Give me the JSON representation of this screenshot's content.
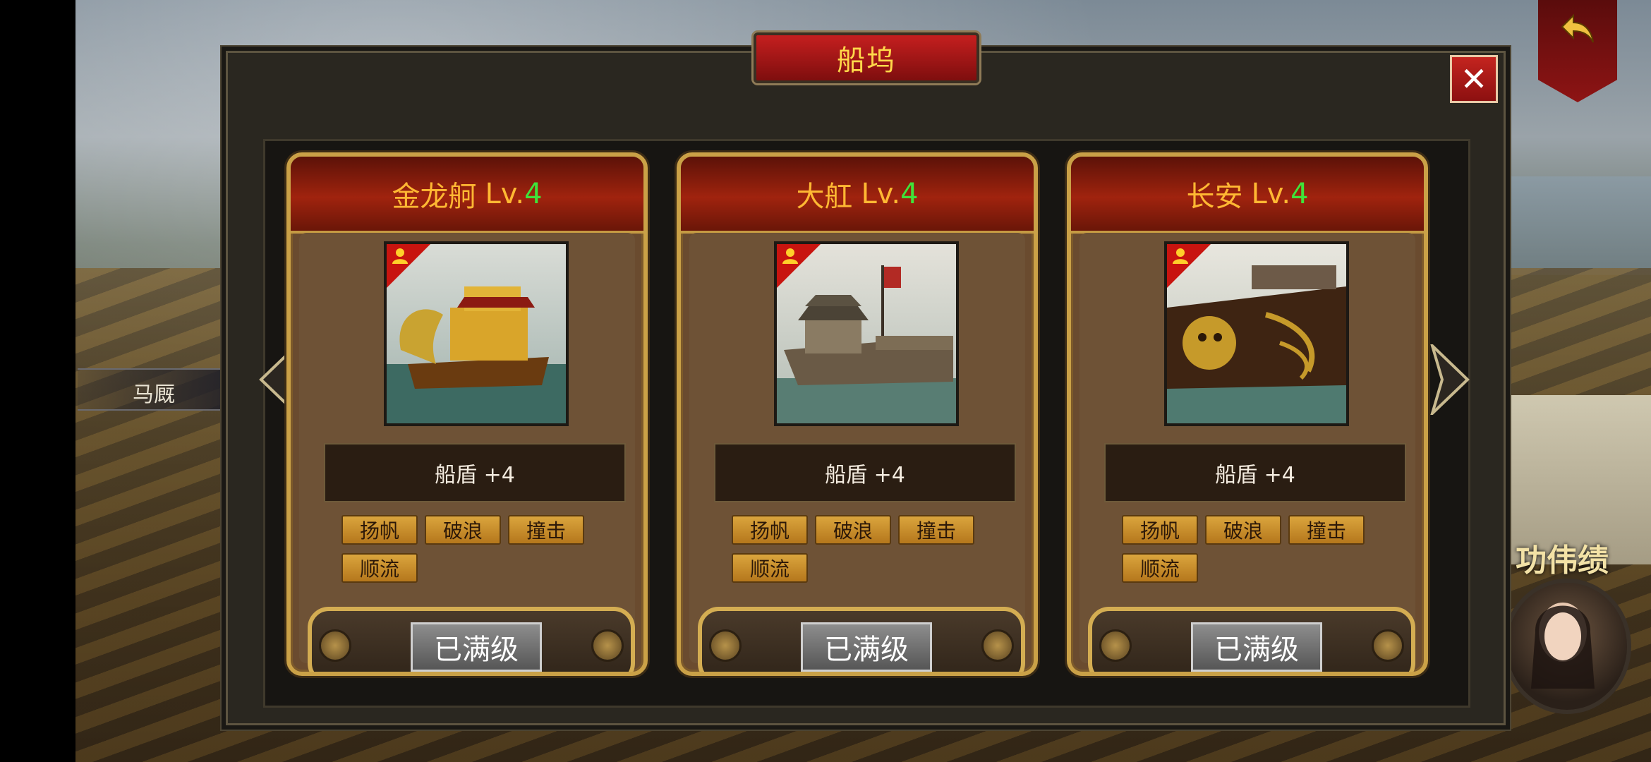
{
  "dialog": {
    "title": "船坞",
    "close": "✕"
  },
  "side_tag": "马厩",
  "background_label": "功伟绩",
  "cards": [
    {
      "name": "金龙舸",
      "level_prefix": "Lv.",
      "level": "4",
      "effect": "船盾 +4",
      "tags": [
        "扬帆",
        "破浪",
        "撞击",
        "顺流"
      ],
      "button": "已满级"
    },
    {
      "name": "大舡",
      "level_prefix": "Lv.",
      "level": "4",
      "effect": "船盾 +4",
      "tags": [
        "扬帆",
        "破浪",
        "撞击",
        "顺流"
      ],
      "button": "已满级"
    },
    {
      "name": "长安",
      "level_prefix": "Lv.",
      "level": "4",
      "effect": "船盾 +4",
      "tags": [
        "扬帆",
        "破浪",
        "撞击",
        "顺流"
      ],
      "button": "已满级"
    }
  ],
  "icons": {
    "prev": "chevron-left-icon",
    "next": "chevron-right-icon",
    "back": "return-arrow-icon"
  },
  "colors": {
    "title_text": "#ffd84a",
    "ship_name": "#ffb833",
    "level_number": "#3fe33a",
    "header_red": "#a0230e",
    "gold_border": "#caa147"
  }
}
